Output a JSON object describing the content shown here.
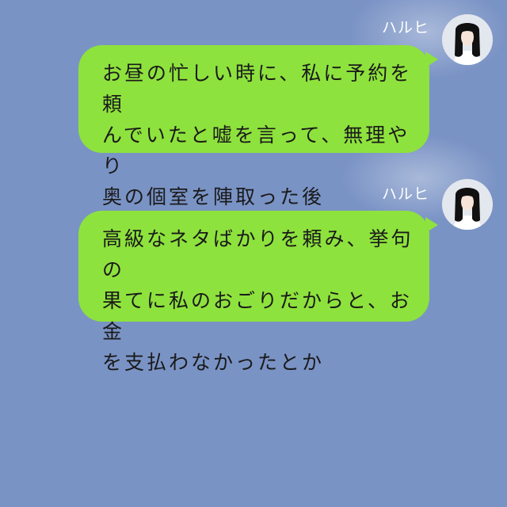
{
  "colors": {
    "background": "#7a93c5",
    "bubble": "#8ee23d",
    "sender_text": "#ffffff",
    "message_text": "#1a1a1a"
  },
  "messages": [
    {
      "sender": "ハルヒ",
      "avatar_icon": "woman-avatar-icon",
      "lines": [
        "お昼の忙しい時に、私に予約を頼",
        "んでいたと嘘を言って、無理やり",
        "奥の個室を陣取った後"
      ]
    },
    {
      "sender": "ハルヒ",
      "avatar_icon": "woman-avatar-icon",
      "lines": [
        "高級なネタばかりを頼み、挙句の",
        "果てに私のおごりだからと、お金",
        "を支払わなかったとか"
      ]
    }
  ]
}
